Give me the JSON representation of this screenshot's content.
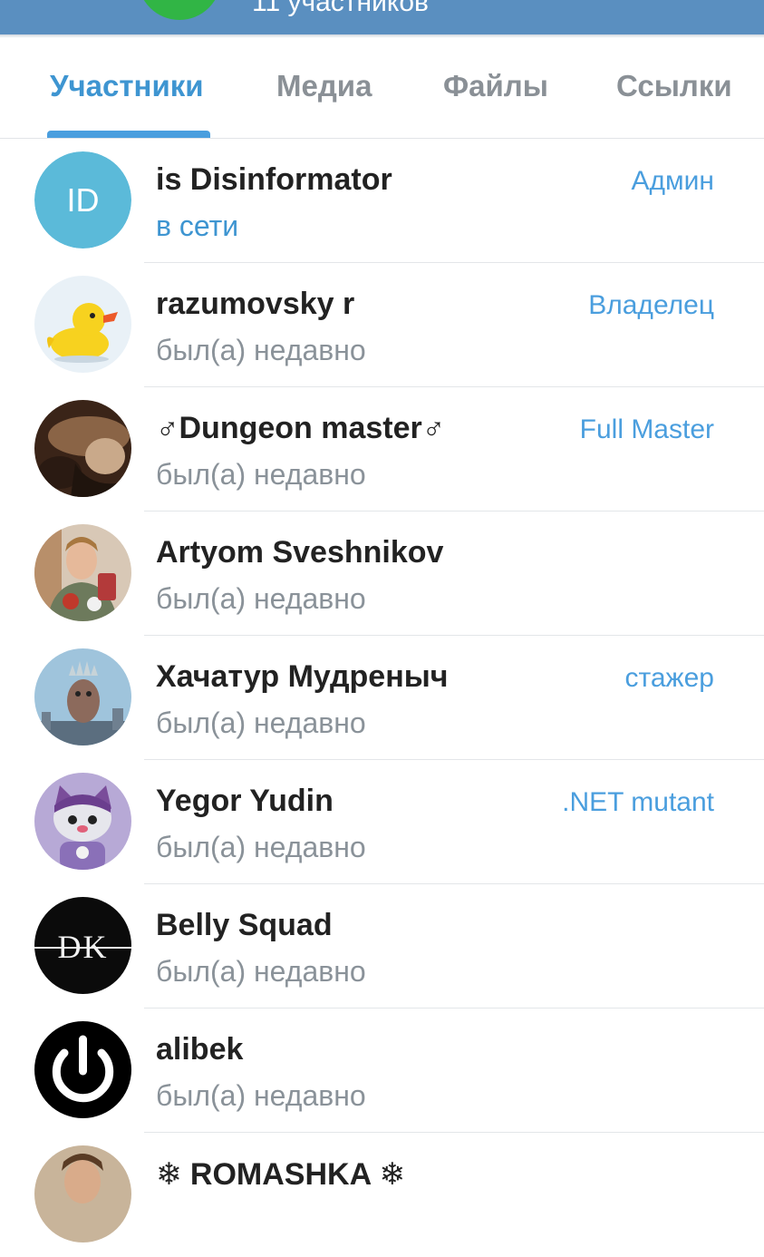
{
  "header": {
    "subtitle": "11 участников"
  },
  "tabs": [
    {
      "label": "Участники"
    },
    {
      "label": "Медиа"
    },
    {
      "label": "Файлы"
    },
    {
      "label": "Ссылки"
    }
  ],
  "members": [
    {
      "name": "is Disinformator",
      "status": "в сети",
      "role": "Админ",
      "initials": "ID"
    },
    {
      "name": "razumovsky r",
      "status": "был(а) недавно",
      "role": "Владелец"
    },
    {
      "name": "♂Dungeon master♂",
      "status": "был(а) недавно",
      "role": "Full Master"
    },
    {
      "name": "Artyom Sveshnikov",
      "status": "был(а) недавно",
      "role": ""
    },
    {
      "name": "Хачатур Мудреныч",
      "status": "был(а) недавно",
      "role": "стажер"
    },
    {
      "name": "Yegor Yudin",
      "status": "был(а) недавно",
      "role": ".NET mutant"
    },
    {
      "name": "Belly Squad",
      "status": "был(а) недавно",
      "role": "",
      "logo_text": "DK"
    },
    {
      "name": "alibek",
      "status": "был(а) недавно",
      "role": ""
    },
    {
      "name": "❄ ROMASHKA ❄",
      "status": "",
      "role": ""
    }
  ],
  "colors": {
    "header": "#5a8fc0",
    "accent": "#3e95d1",
    "initials_avatar": "#5bbad9"
  },
  "icons": {
    "avatar_razumovsky": "rubber-duck-icon",
    "avatar_alibek": "power-icon"
  }
}
